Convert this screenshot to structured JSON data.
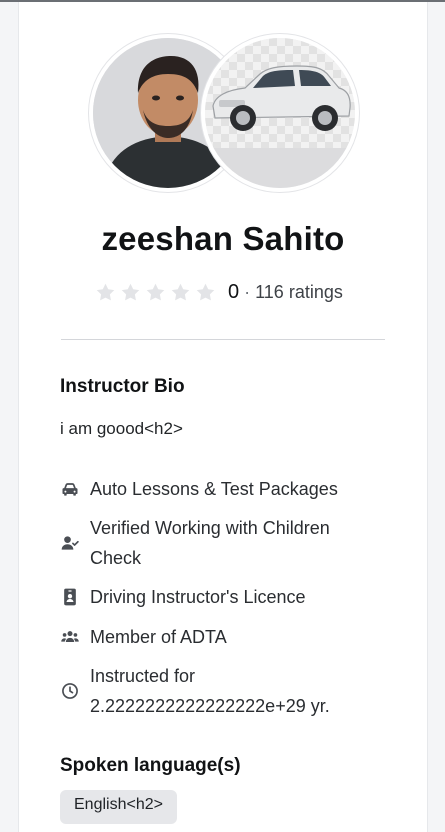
{
  "profile": {
    "name": "zeeshan Sahito",
    "rating_value": "0",
    "rating_separator": "·",
    "rating_count_text": "116 ratings",
    "stars_filled": 0,
    "stars_total": 5
  },
  "bio": {
    "title": "Instructor Bio",
    "text": "i am goood<h2>"
  },
  "features": [
    {
      "icon": "car-icon",
      "label": "Auto Lessons & Test Packages"
    },
    {
      "icon": "user-check-icon",
      "label": "Verified Working with Children Check"
    },
    {
      "icon": "id-card-icon",
      "label": "Driving Instructor's Licence"
    },
    {
      "icon": "users-group-icon",
      "label": "Member of ADTA"
    },
    {
      "icon": "clock-icon",
      "label": "Instructed for 2.2222222222222222e+29 yr."
    }
  ],
  "languages": {
    "title": "Spoken language(s)",
    "items": [
      "English<h2>"
    ]
  },
  "colors": {
    "text": "#111315",
    "muted": "#6b7077",
    "pill_bg": "#e6e7ea",
    "star_empty": "#e3e4e7"
  }
}
